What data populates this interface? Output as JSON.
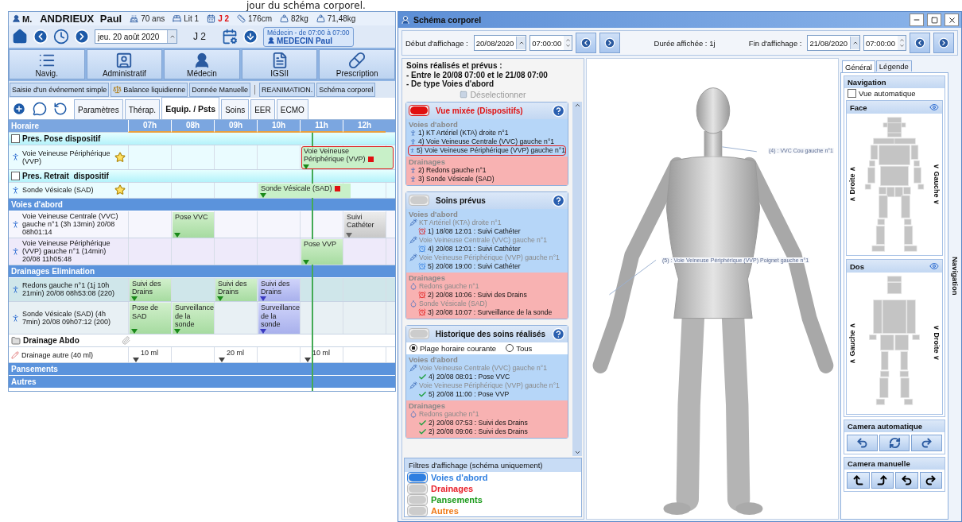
{
  "caption": "jour du schéma corporel.",
  "patient": {
    "title": "M.",
    "name": "ANDRIEUX Paul",
    "stats": [
      {
        "kind": "age",
        "text": "70 ans"
      },
      {
        "kind": "bed",
        "text": "Lit 1"
      },
      {
        "kind": "day",
        "text": "J 2"
      },
      {
        "kind": "height",
        "text": "176cm"
      },
      {
        "kind": "weight",
        "text": "82kg"
      },
      {
        "kind": "weight",
        "text": "71,48kg"
      }
    ]
  },
  "toolbar": {
    "date": "jeu. 20 août 2020",
    "day": "J 2",
    "doctor": {
      "shift": "Médecin - de 07:00 à 07:00",
      "name": "MEDECIN Paul"
    }
  },
  "modules": [
    {
      "kind": "navig",
      "label": "Navig."
    },
    {
      "kind": "admin",
      "label": "Administratif"
    },
    {
      "kind": "doctor",
      "label": "Médecin"
    },
    {
      "kind": "score",
      "label": "IGSII"
    },
    {
      "kind": "prescription",
      "label": "Prescription"
    }
  ],
  "actions": [
    {
      "kind": "button",
      "label": "Saisie d'un événement simple"
    },
    {
      "kind": "balance",
      "label": "Balance liquidienne"
    },
    {
      "kind": "button",
      "label": "Donnée Manuelle"
    },
    {
      "kind": "separator"
    },
    {
      "kind": "button",
      "label": "REANIMATION."
    },
    {
      "kind": "button",
      "label": "Schéma corporel"
    }
  ],
  "tabs": [
    {
      "label": "Paramètres",
      "selected": false
    },
    {
      "label": "Thérap.",
      "selected": false
    },
    {
      "label": "Equip. / Psts",
      "selected": true
    },
    {
      "label": "Soins",
      "selected": false
    },
    {
      "label": "EER",
      "selected": false
    },
    {
      "label": "ECMO",
      "selected": false
    }
  ],
  "grid": {
    "heading": "Horaire",
    "hours": [
      "07h",
      "08h",
      "09h",
      "10h",
      "11h",
      "12h"
    ],
    "rows": [
      {
        "kind": "check_group",
        "checked": false,
        "label": "Pres. Pose dispositif"
      },
      {
        "kind": "item",
        "starred": true,
        "label": "Voie Veineuse Périphérique (VVP)",
        "slots": [
          {
            "kind": "empty"
          },
          {
            "kind": "empty"
          },
          {
            "kind": "empty"
          },
          {
            "kind": "empty"
          },
          {
            "kind": "prescription",
            "highlighted": true,
            "text": "Voie Veineuse Périphérique (VVP)"
          },
          {
            "kind": "empty"
          }
        ]
      },
      {
        "kind": "check_group",
        "checked": false,
        "label": "Pres. Retrait  dispositif"
      },
      {
        "kind": "item",
        "starred": true,
        "label": "Sonde Vésicale (SAD)",
        "slots": [
          {
            "kind": "empty"
          },
          {
            "kind": "empty"
          },
          {
            "kind": "empty"
          },
          {
            "kind": "prescription",
            "highlighted": false,
            "text": "Sonde Vésicale (SAD)"
          },
          {
            "kind": "empty"
          },
          {
            "kind": "empty"
          }
        ]
      },
      {
        "kind": "section",
        "label": "Voies d'abord"
      },
      {
        "kind": "item",
        "starred": false,
        "label": "Voie Veineuse Centrale (VVC) gauche n°1 (3h 13min) 20/08 08h01:14",
        "slots": [
          {
            "kind": "empty"
          },
          {
            "kind": "done",
            "text": "Pose VVC"
          },
          {
            "kind": "empty"
          },
          {
            "kind": "empty"
          },
          {
            "kind": "empty"
          },
          {
            "kind": "pending",
            "text": "Suivi Cathéter"
          }
        ]
      },
      {
        "kind": "item",
        "starred": false,
        "label": "Voie Veineuse Périphérique (VVP) gauche n°1 (14min) 20/08 11h05:48",
        "slots": [
          {
            "kind": "empty"
          },
          {
            "kind": "empty"
          },
          {
            "kind": "empty"
          },
          {
            "kind": "empty"
          },
          {
            "kind": "done",
            "text": "Pose VVP"
          },
          {
            "kind": "empty"
          }
        ]
      },
      {
        "kind": "section",
        "label": "Drainages Elimination"
      },
      {
        "kind": "item",
        "starred": false,
        "label": "Redons gauche n°1 (1j 10h 21min) 20/08 08h53:08 (220)",
        "slots": [
          {
            "kind": "done",
            "text": "Suivi des Drains"
          },
          {
            "kind": "empty"
          },
          {
            "kind": "done",
            "text": "Suivi des Drains"
          },
          {
            "kind": "planned",
            "text": "Suivi des Drains"
          },
          {
            "kind": "empty"
          },
          {
            "kind": "empty"
          }
        ]
      },
      {
        "kind": "item",
        "starred": false,
        "label": "Sonde Vésicale (SAD) (4h 7min) 20/08 09h07:12 (200)",
        "slots": [
          {
            "kind": "done",
            "text": "Pose de SAD"
          },
          {
            "kind": "done",
            "text": "Surveillance de la sonde"
          },
          {
            "kind": "empty"
          },
          {
            "kind": "planned",
            "text": "Surveillance de la sonde"
          },
          {
            "kind": "empty"
          },
          {
            "kind": "empty"
          }
        ]
      },
      {
        "kind": "folder_group",
        "label": "Drainage Abdo"
      },
      {
        "kind": "drain_item",
        "starred": false,
        "label": "Drainage autre (40 ml)",
        "slots": [
          {
            "kind": "volume",
            "text": "10 ml"
          },
          {
            "kind": "empty"
          },
          {
            "kind": "volume",
            "text": "20 ml"
          },
          {
            "kind": "empty"
          },
          {
            "kind": "volume",
            "text": "10 ml"
          },
          {
            "kind": "empty"
          }
        ]
      },
      {
        "kind": "section",
        "label": "Pansements"
      },
      {
        "kind": "section",
        "label": "Autres"
      }
    ]
  },
  "window": {
    "title": "Schéma corporel",
    "start": {
      "label": "Début d'affichage :",
      "date": "20/08/2020",
      "time": "07:00:00"
    },
    "duration": "Durée affichée : 1j",
    "end": {
      "label": "Fin d'affichage :",
      "date": "21/08/2020",
      "time": "07:00:00"
    }
  },
  "list": {
    "summary": [
      "Soins réalisés et prévus :",
      "- Entre le 20/08 07:00 et le 21/08 07:00",
      "- De type Voies d'abord"
    ],
    "deselect": "Déselectionner",
    "cards": [
      {
        "title": "Vue mixée (Dispositifs)",
        "on": true,
        "groups": [
          {
            "kind": "access",
            "label": "Voies d'abord",
            "entries": [
              {
                "kind": "device",
                "text": "1) KT Artériel (KTA) droite n°1",
                "selected": false
              },
              {
                "kind": "device",
                "text": "4) Voie Veineuse Centrale (VVC) gauche n°1",
                "selected": false
              },
              {
                "kind": "device",
                "text": "5) Voie Veineuse Périphérique (VVP) gauche n°1",
                "selected": true
              }
            ]
          },
          {
            "kind": "drain",
            "label": "Drainages",
            "entries": [
              {
                "kind": "device",
                "text": "2) Redons gauche n°1",
                "selected": false
              },
              {
                "kind": "device",
                "text": "3) Sonde Vésicale (SAD)",
                "selected": false
              }
            ]
          }
        ]
      },
      {
        "title": "Soins prévus",
        "on": false,
        "groups": [
          {
            "kind": "access",
            "label": "Voies d'abord",
            "entries": [
              {
                "kind": "source",
                "text": "KT Artériel (KTA) droite n°1"
              },
              {
                "kind": "care",
                "overdue": true,
                "text": "1) 18/08 12:01 : Suivi Cathéter"
              },
              {
                "kind": "source",
                "text": "Voie Veineuse Centrale (VVC) gauche n°1"
              },
              {
                "kind": "care",
                "overdue": false,
                "text": "4) 20/08 12:01 : Suivi Cathéter"
              },
              {
                "kind": "source",
                "text": "Voie Veineuse Périphérique (VVP) gauche n°1"
              },
              {
                "kind": "care",
                "overdue": false,
                "text": "5) 20/08 19:00 : Suivi Cathéter"
              }
            ]
          },
          {
            "kind": "drain",
            "label": "Drainages",
            "entries": [
              {
                "kind": "source",
                "text": "Redons gauche n°1"
              },
              {
                "kind": "care",
                "overdue": true,
                "text": "2) 20/08 10:06 : Suivi des Drains"
              },
              {
                "kind": "source",
                "text": "Sonde Vésicale (SAD)"
              },
              {
                "kind": "care",
                "overdue": true,
                "text": "3) 20/08 10:07 : Surveillance de la sonde"
              }
            ]
          }
        ]
      },
      {
        "title": "Historique des soins réalisés",
        "on": false,
        "radios": [
          {
            "label": "Plage horaire courante",
            "selected": true
          },
          {
            "label": "Tous",
            "selected": false
          }
        ],
        "groups": [
          {
            "kind": "access",
            "label": "Voies d'abord",
            "entries": [
              {
                "kind": "source",
                "text": "Voie Veineuse Centrale (VVC) gauche n°1"
              },
              {
                "kind": "done",
                "text": "4) 20/08 08:01 : Pose VVC"
              },
              {
                "kind": "source",
                "text": "Voie Veineuse Périphérique (VVP) gauche n°1"
              },
              {
                "kind": "done",
                "text": "5) 20/08 11:00 : Pose VVP"
              }
            ]
          },
          {
            "kind": "drain",
            "label": "Drainages",
            "entries": [
              {
                "kind": "source",
                "text": "Redons gauche n°1"
              },
              {
                "kind": "done",
                "text": "2) 20/08 07:53 : Suivi des Drains"
              },
              {
                "kind": "done",
                "text": "2) 20/08 09:06 : Suivi des Drains"
              }
            ]
          }
        ]
      }
    ],
    "filters": {
      "title": "Filtres d'affichage (schéma uniquement)",
      "items": [
        {
          "label": "Voies d'abord",
          "on": true,
          "color": "#2f7fe0"
        },
        {
          "label": "Drainages",
          "on": false,
          "color": "#e8202a"
        },
        {
          "label": "Pansements",
          "on": false,
          "color": "#1a9a1a"
        },
        {
          "label": "Autres",
          "on": false,
          "color": "#f07a18"
        }
      ]
    }
  },
  "body_view": {
    "labels": [
      "(4) : VVC Cou gauche n°1",
      "(5) : Voie Veineuse Périphérique (VVP) Poignet gauche n°1"
    ]
  },
  "side": {
    "tabs": [
      {
        "label": "Général",
        "selected": true
      },
      {
        "label": "Légende",
        "selected": false
      }
    ],
    "title": "Navigation",
    "auto": {
      "label": "Vue automatique",
      "checked": false
    },
    "views": [
      {
        "kind": "front",
        "title": "Face",
        "left": "∧ Droite ∧",
        "right": "∨ Gauche ∨"
      },
      {
        "kind": "back",
        "title": "Dos",
        "left": "∧ Gauche ∧",
        "right": "∨ Droite ∨"
      }
    ],
    "camera_auto": "Camera automatique",
    "camera_manual": "Camera manuelle",
    "side_label": "Navigation"
  }
}
